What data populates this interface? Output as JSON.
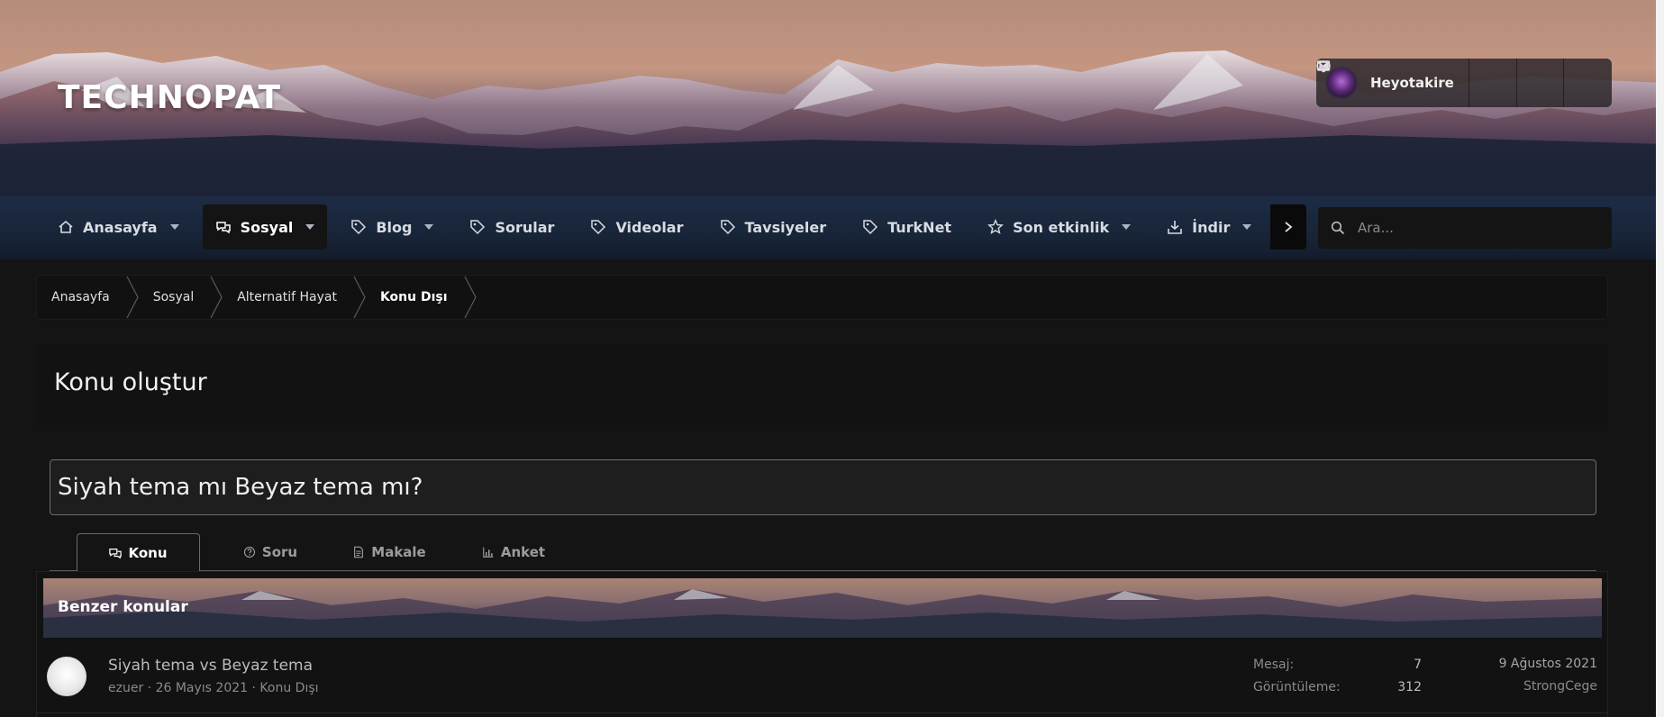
{
  "brand": {
    "logo_text": "TECHNOPAT"
  },
  "user": {
    "name": "Heyotakire"
  },
  "nav": {
    "items": [
      {
        "label": "Anasayfa",
        "icon": "home-icon",
        "has_menu": true
      },
      {
        "label": "Sosyal",
        "icon": "chat-icon",
        "has_menu": true,
        "active": true
      },
      {
        "label": "Blog",
        "icon": "tag-icon",
        "has_menu": true
      },
      {
        "label": "Sorular",
        "icon": "tag-icon",
        "has_menu": false
      },
      {
        "label": "Videolar",
        "icon": "tag-icon",
        "has_menu": false
      },
      {
        "label": "Tavsiyeler",
        "icon": "tag-icon",
        "has_menu": false
      },
      {
        "label": "TurkNet",
        "icon": "tag-icon",
        "has_menu": false
      },
      {
        "label": "Son etkinlik",
        "icon": "star-icon",
        "has_menu": true
      },
      {
        "label": "İndir",
        "icon": "download-icon",
        "has_menu": true
      }
    ]
  },
  "search": {
    "placeholder": "Ara..."
  },
  "breadcrumb": [
    "Anasayfa",
    "Sosyal",
    "Alternatif Hayat",
    "Konu Dışı"
  ],
  "page": {
    "title": "Konu oluştur"
  },
  "thread_title_input": {
    "value": "Siyah tema mı Beyaz tema mı?"
  },
  "tabs": [
    {
      "label": "Konu",
      "icon": "chat-icon",
      "active": true
    },
    {
      "label": "Soru",
      "icon": "question-icon"
    },
    {
      "label": "Makale",
      "icon": "document-icon"
    },
    {
      "label": "Anket",
      "icon": "bar-chart-icon"
    }
  ],
  "similar": {
    "heading": "Benzer konular",
    "threads": [
      {
        "title": "Siyah tema vs Beyaz tema",
        "author": "ezuer",
        "date": "26 Mayıs 2021",
        "forum": "Konu Dışı",
        "meta_sep": " · ",
        "replies_label": "Mesaj:",
        "replies": "7",
        "views_label": "Görüntüleme:",
        "views": "312",
        "last_date": "9 Ağustos 2021",
        "last_user": "StrongCege"
      }
    ]
  },
  "colors": {
    "background": "#141414",
    "navbar": "#1d2c44",
    "panel": "#121212",
    "text": "#e6e6e6"
  }
}
